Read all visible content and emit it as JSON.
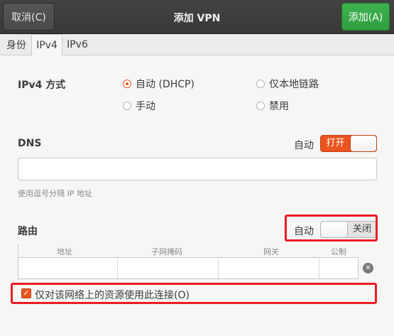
{
  "header": {
    "cancel_label": "取消(C)",
    "title": "添加 VPN",
    "add_label": "添加(A)"
  },
  "tabs": [
    {
      "label": "身份",
      "active": false
    },
    {
      "label": "IPv4",
      "active": true
    },
    {
      "label": "IPv6",
      "active": false
    }
  ],
  "ipv4": {
    "method_label": "IPv4 方式",
    "options": [
      {
        "label": "自动 (DHCP)",
        "selected": true
      },
      {
        "label": "仅本地链路",
        "selected": false
      },
      {
        "label": "手动",
        "selected": false
      },
      {
        "label": "禁用",
        "selected": false
      }
    ]
  },
  "dns": {
    "label": "DNS",
    "auto_label": "自动",
    "switch_text": "打开",
    "switch_on": true,
    "value": "",
    "hint": "使用逗号分隔 IP 地址"
  },
  "routes": {
    "label": "路由",
    "auto_label": "自动",
    "switch_text": "关闭",
    "switch_on": false,
    "columns": [
      "地址",
      "子网掩码",
      "网关",
      "公制"
    ],
    "rows": [
      [
        "",
        "",
        "",
        ""
      ]
    ]
  },
  "restrict": {
    "label": "仅对该网络上的资源使用此连接(O)",
    "checked": true
  },
  "colors": {
    "accent": "#e95420",
    "add_button": "#37a847",
    "highlight": "#ec1c24"
  },
  "icons": {
    "clear_row": "clear-circle-icon",
    "checkmark": "checkmark-icon"
  }
}
